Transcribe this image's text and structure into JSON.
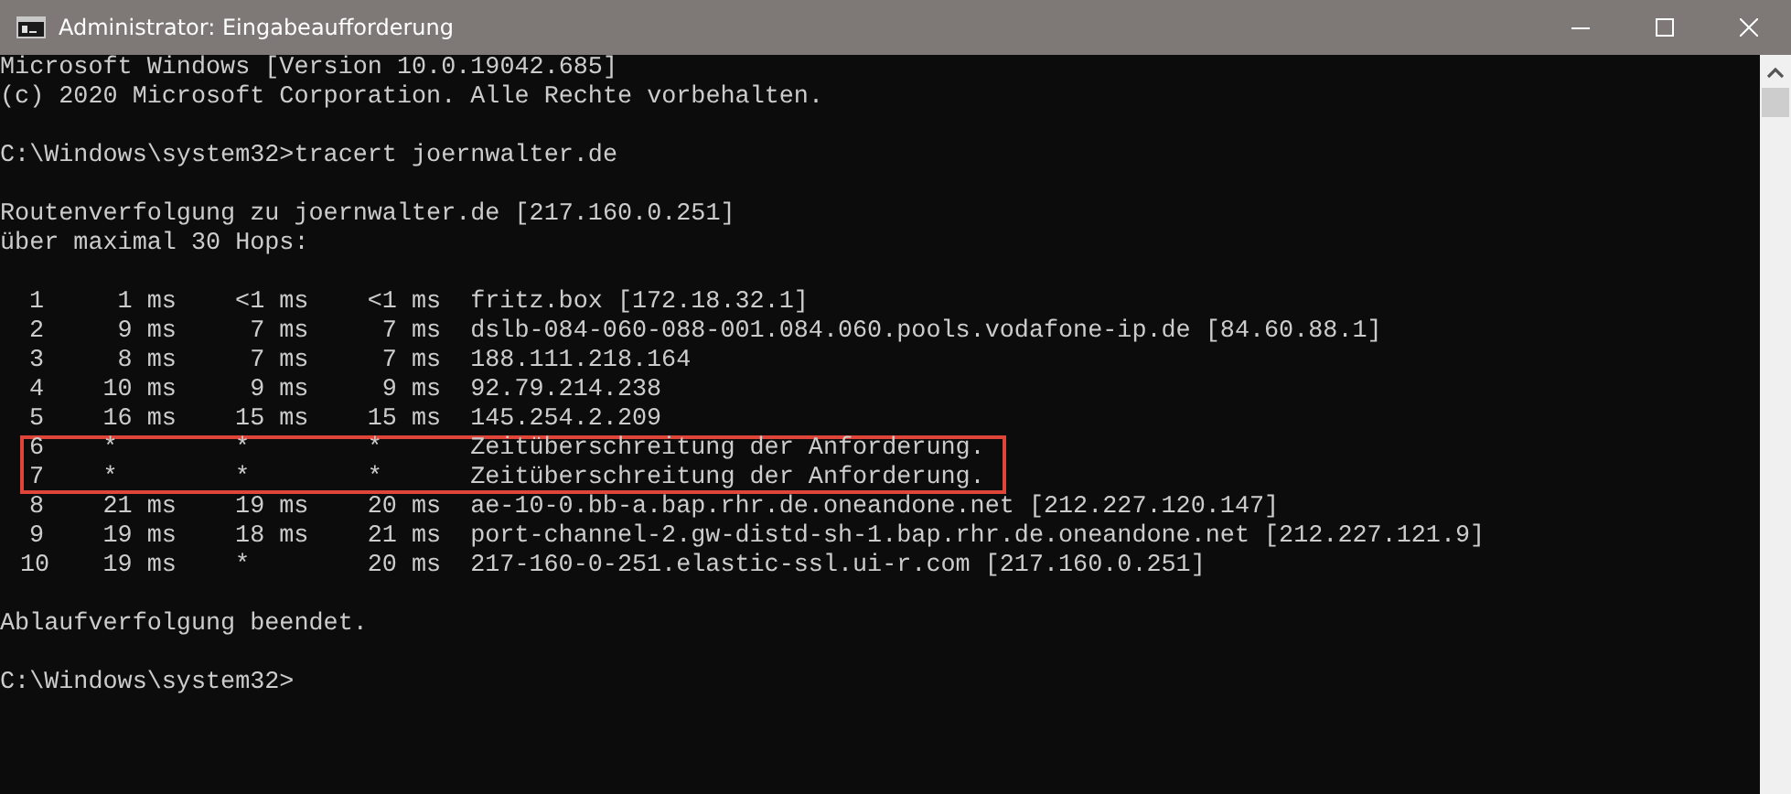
{
  "window": {
    "title": "Administrator: Eingabeaufforderung"
  },
  "console": {
    "lines": [
      {
        "kind": "text",
        "text": "Microsoft Windows [Version 10.0.19042.685]"
      },
      {
        "kind": "text",
        "text": "(c) 2020 Microsoft Corporation. Alle Rechte vorbehalten."
      },
      {
        "kind": "blank"
      },
      {
        "kind": "text",
        "text": "C:\\Windows\\system32>tracert joernwalter.de"
      },
      {
        "kind": "blank"
      },
      {
        "kind": "text",
        "text": "Routenverfolgung zu joernwalter.de [217.160.0.251]"
      },
      {
        "kind": "text",
        "text": "über maximal 30 Hops:"
      },
      {
        "kind": "blank"
      },
      {
        "kind": "hop",
        "hop": "1",
        "times": [
          {
            "kind": "time",
            "text": "1 ms"
          },
          {
            "kind": "time",
            "text": "<1 ms"
          },
          {
            "kind": "time",
            "text": "<1 ms"
          }
        ],
        "host": "fritz.box [172.18.32.1]",
        "highlighted": false
      },
      {
        "kind": "hop",
        "hop": "2",
        "times": [
          {
            "kind": "time",
            "text": "9 ms"
          },
          {
            "kind": "time",
            "text": "7 ms"
          },
          {
            "kind": "time",
            "text": "7 ms"
          }
        ],
        "host": "dslb-084-060-088-001.084.060.pools.vodafone-ip.de [84.60.88.1]",
        "highlighted": false
      },
      {
        "kind": "hop",
        "hop": "3",
        "times": [
          {
            "kind": "time",
            "text": "8 ms"
          },
          {
            "kind": "time",
            "text": "7 ms"
          },
          {
            "kind": "time",
            "text": "7 ms"
          }
        ],
        "host": "188.111.218.164",
        "highlighted": false
      },
      {
        "kind": "hop",
        "hop": "4",
        "times": [
          {
            "kind": "time",
            "text": "10 ms"
          },
          {
            "kind": "time",
            "text": "9 ms"
          },
          {
            "kind": "time",
            "text": "9 ms"
          }
        ],
        "host": "92.79.214.238",
        "highlighted": false
      },
      {
        "kind": "hop",
        "hop": "5",
        "times": [
          {
            "kind": "time",
            "text": "16 ms"
          },
          {
            "kind": "time",
            "text": "15 ms"
          },
          {
            "kind": "time",
            "text": "15 ms"
          }
        ],
        "host": "145.254.2.209",
        "highlighted": false
      },
      {
        "kind": "hop",
        "hop": "6",
        "times": [
          {
            "kind": "timeout",
            "text": "*"
          },
          {
            "kind": "timeout",
            "text": "*"
          },
          {
            "kind": "timeout",
            "text": "*"
          }
        ],
        "host": "Zeitüberschreitung der Anforderung.",
        "highlighted": true
      },
      {
        "kind": "hop",
        "hop": "7",
        "times": [
          {
            "kind": "timeout",
            "text": "*"
          },
          {
            "kind": "timeout",
            "text": "*"
          },
          {
            "kind": "timeout",
            "text": "*"
          }
        ],
        "host": "Zeitüberschreitung der Anforderung.",
        "highlighted": true
      },
      {
        "kind": "hop",
        "hop": "8",
        "times": [
          {
            "kind": "time",
            "text": "21 ms"
          },
          {
            "kind": "time",
            "text": "19 ms"
          },
          {
            "kind": "time",
            "text": "20 ms"
          }
        ],
        "host": "ae-10-0.bb-a.bap.rhr.de.oneandone.net [212.227.120.147]",
        "highlighted": false
      },
      {
        "kind": "hop",
        "hop": "9",
        "times": [
          {
            "kind": "time",
            "text": "19 ms"
          },
          {
            "kind": "time",
            "text": "18 ms"
          },
          {
            "kind": "time",
            "text": "21 ms"
          }
        ],
        "host": "port-channel-2.gw-distd-sh-1.bap.rhr.de.oneandone.net [212.227.121.9]",
        "highlighted": false
      },
      {
        "kind": "hop",
        "hop": "10",
        "times": [
          {
            "kind": "time",
            "text": "19 ms"
          },
          {
            "kind": "timeout",
            "text": "*"
          },
          {
            "kind": "time",
            "text": "20 ms"
          }
        ],
        "host": "217-160-0-251.elastic-ssl.ui-r.com [217.160.0.251]",
        "highlighted": false
      },
      {
        "kind": "blank"
      },
      {
        "kind": "text",
        "text": "Ablaufverfolgung beendet."
      },
      {
        "kind": "blank"
      },
      {
        "kind": "text",
        "text": "C:\\Windows\\system32>"
      }
    ]
  }
}
